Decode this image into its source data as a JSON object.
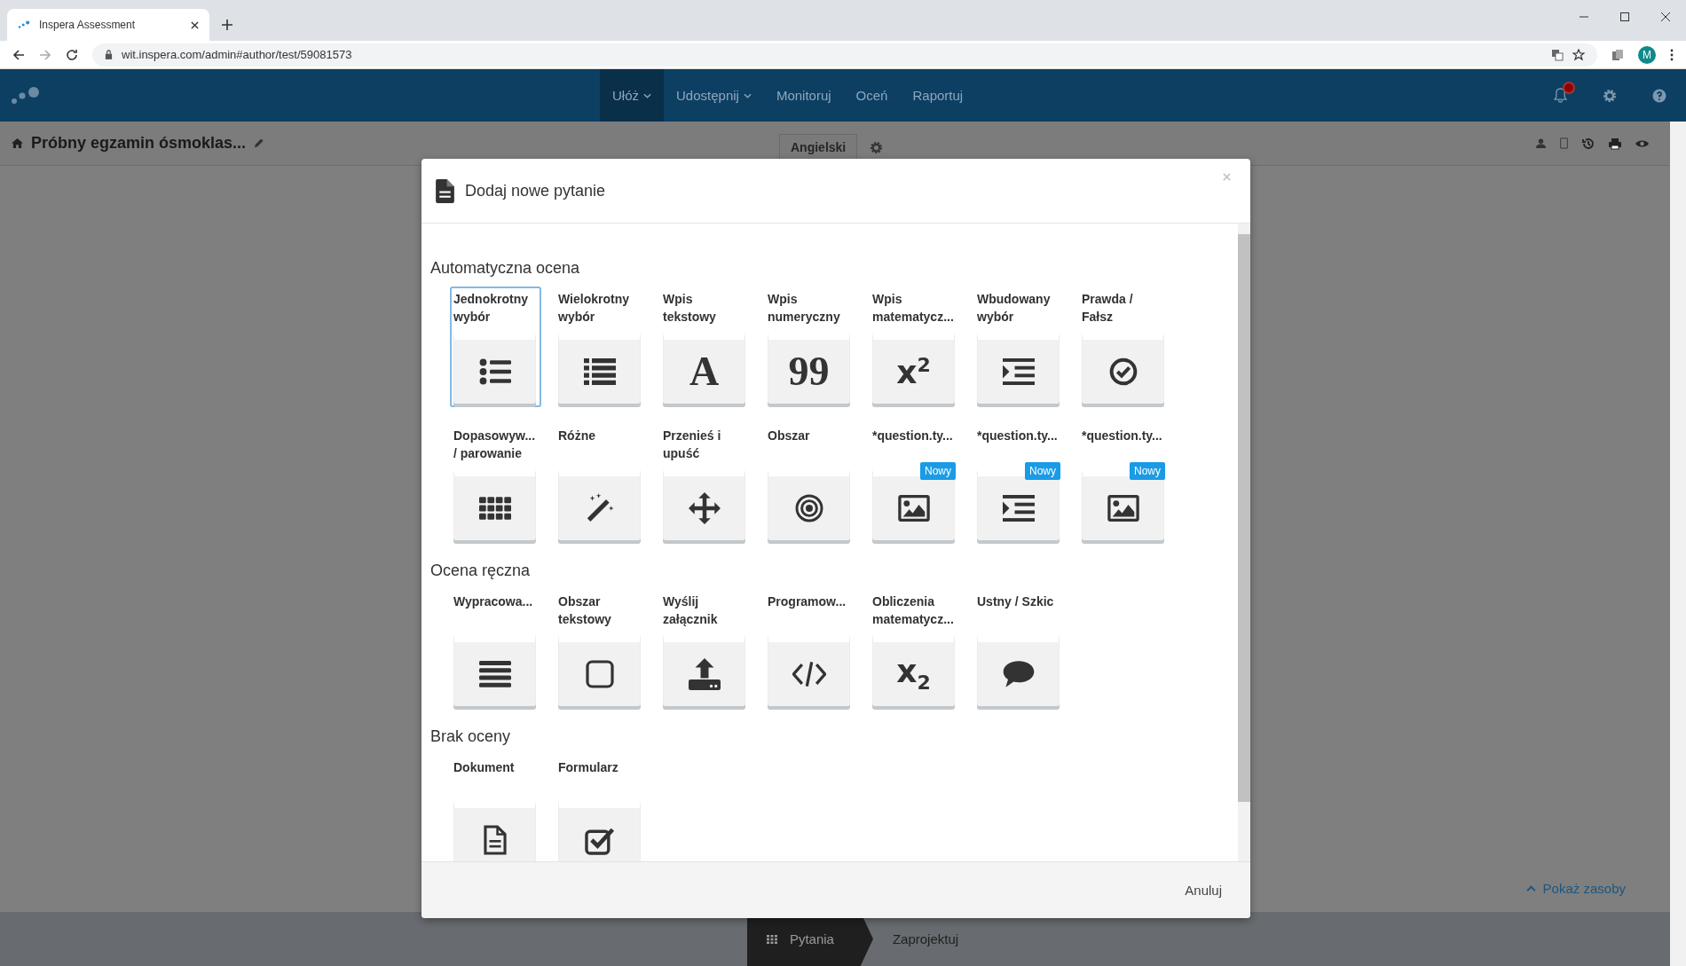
{
  "browser": {
    "tab_title": "Inspera Assessment",
    "url": "wit.inspera.com/admin#author/test/59081573",
    "profile_initial": "M"
  },
  "nav": {
    "items": [
      {
        "label": "Ułóż",
        "selected": true,
        "dropdown": true
      },
      {
        "label": "Udostępnij",
        "selected": false,
        "dropdown": true
      },
      {
        "label": "Monitoruj",
        "selected": false,
        "dropdown": false
      },
      {
        "label": "Oceń",
        "selected": false,
        "dropdown": false
      },
      {
        "label": "Raportuj",
        "selected": false,
        "dropdown": false
      }
    ],
    "has_notification": true
  },
  "page_header": {
    "title": "Próbny egzamin ósmoklas...",
    "language": "Angielski"
  },
  "modal": {
    "title": "Dodaj nowe pytanie",
    "sections": [
      {
        "heading": "Automatyczna ocena",
        "items": [
          {
            "label": "Jednokrotny wybór",
            "kind": "bulletlist",
            "selected": true
          },
          {
            "label": "Wielokrotny wybór",
            "kind": "list",
            "selected": false
          },
          {
            "label": "Wpis tekstowy",
            "kind": "letter",
            "glyph": "A",
            "selected": false
          },
          {
            "label": "Wpis numeryczny",
            "kind": "letter",
            "glyph": "99",
            "selected": false
          },
          {
            "label": "Wpis matematycz...",
            "kind": "formula",
            "glyph": "x$^{2}$",
            "selected": false
          },
          {
            "label": "Wbudowany wybór",
            "kind": "indent",
            "selected": false
          },
          {
            "label": "Prawda / Fałsz",
            "kind": "check",
            "selected": false
          },
          {
            "label": "Dopasowyw... / parowanie",
            "kind": "grid",
            "selected": false
          },
          {
            "label": "Różne",
            "kind": "wand",
            "selected": false
          },
          {
            "label": "Przenieś i upuść",
            "kind": "move",
            "selected": false
          },
          {
            "label": "Obszar",
            "kind": "target",
            "selected": false
          },
          {
            "label": "*question.ty...",
            "kind": "image",
            "badge": "Nowy",
            "selected": false
          },
          {
            "label": "*question.ty...",
            "kind": "indent",
            "badge": "Nowy",
            "selected": false
          },
          {
            "label": "*question.ty...",
            "kind": "image",
            "badge": "Nowy",
            "selected": false
          }
        ]
      },
      {
        "heading": "Ocena ręczna",
        "items": [
          {
            "label": "Wypracowa...",
            "kind": "lines",
            "selected": false
          },
          {
            "label": "Obszar tekstowy",
            "kind": "square",
            "selected": false
          },
          {
            "label": "Wyślij załącznik",
            "kind": "upload",
            "selected": false
          },
          {
            "label": "Programow...",
            "kind": "code",
            "selected": false
          },
          {
            "label": "Obliczenia matematycz...",
            "kind": "formula",
            "glyph": "x$_{2}$",
            "selected": false
          },
          {
            "label": "Ustny / Szkic",
            "kind": "speech",
            "selected": false
          }
        ]
      },
      {
        "heading": "Brak oceny",
        "items": [
          {
            "label": "Dokument",
            "kind": "document",
            "selected": false
          },
          {
            "label": "Formularz",
            "kind": "checkbox",
            "selected": false
          }
        ]
      }
    ],
    "cancel": "Anuluj"
  },
  "resources_link": "Pokaż zasoby",
  "steps": [
    {
      "label": "Pytania",
      "selected": true
    },
    {
      "label": "Zaprojektuj",
      "selected": false
    }
  ]
}
